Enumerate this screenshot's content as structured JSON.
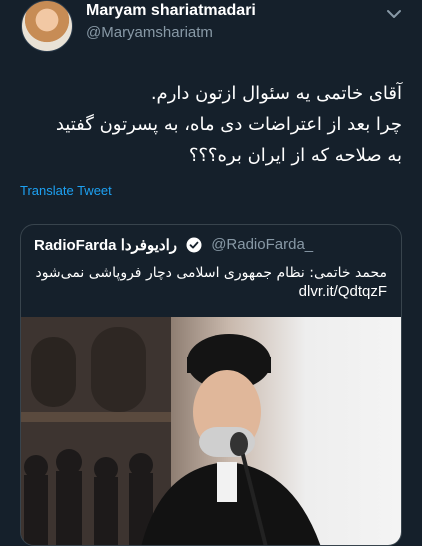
{
  "tweet": {
    "author_name": "Maryam shariatmadari",
    "author_handle": "@Maryamshariatm",
    "text_lines": [
      "آقای خاتمی یه سئوال ازتون دارم.",
      "چرا بعد از اعتراضات دی ماه، به پسرتون گفتید",
      "به صلاحه که از ایران بره؟؟؟"
    ],
    "translate_label": "Translate Tweet"
  },
  "quoted": {
    "name": "RadioFarda رادیوفردا",
    "handle": "@RadioFarda_",
    "text": "محمد خاتمی: نظام جمهوری اسلامی دچار فروپاشی نمی‌شود",
    "link": "dlvr.it/QdtqzF"
  },
  "icons": {
    "menu": "chevron-down-icon",
    "verified": "verified-badge-icon",
    "avatar": "avatar"
  },
  "colors": {
    "background": "#15202b",
    "accent": "#1da1f2",
    "secondary_text": "#8899a6",
    "border": "#38444d"
  }
}
